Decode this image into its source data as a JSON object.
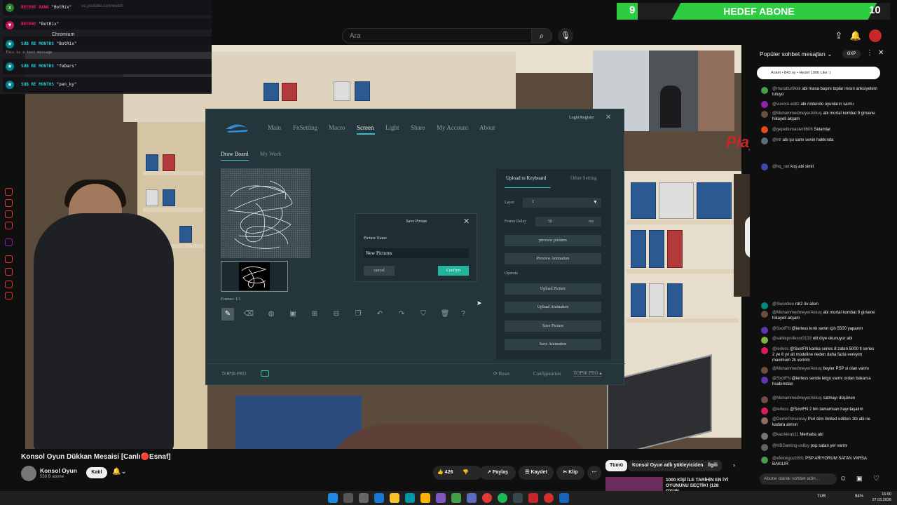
{
  "youtube": {
    "search_placeholder": "Ara",
    "video_title": "Konsol Oyun Dükkan Mesaisi [Canlı🔴Esnaf]",
    "channel_name": "Konsol Oyun",
    "channel_subs": "538 B abone",
    "join_label": "Katıl",
    "like_count": "426",
    "share_label": "Paylaş",
    "save_label": "Kaydet",
    "clip_label": "Klip",
    "related_chips": [
      "Tümü",
      "Konsol Oyun adlı yükleyiciden",
      "İlgili"
    ],
    "related_video_title": "1000 KİŞİ İLE TARİHİN EN İYİ OYUNUNU SEÇTİK! (128 OYUN..."
  },
  "stream_overlay": {
    "subgoal": {
      "current": "9",
      "title": "HEDEF ABONE",
      "target": "10"
    },
    "alerts": [
      {
        "label": "RECENT RANK",
        "text": "\"BotRix\"",
        "color": "#2e7d32",
        "icon": "x"
      },
      {
        "label": "RECENT",
        "text": "\"BotRix\"",
        "color": "#c2185b",
        "icon": "♥"
      },
      {
        "label": "SUB RE MONTHS",
        "text": "\"BotRix\"",
        "color": "#00838f",
        "icon": "★"
      },
      {
        "label": "SUB RE MONTHS",
        "text": "\"feDars\"",
        "color": "#00838f",
        "icon": "★"
      },
      {
        "label": "SUB RE MONTHS",
        "text": "\"pen_ky\"",
        "color": "#00838f",
        "icon": "★"
      }
    ],
    "chatbox_line": "This is a test message",
    "browser_url": "uc.youtube.com/watch",
    "browser_tab": "Chromium",
    "watermark": "PlayNoGame"
  },
  "app": {
    "nav": [
      "Main",
      "FnSetting",
      "Macro",
      "Screen",
      "Light",
      "Share",
      "My Account",
      "About"
    ],
    "active_nav": "Screen",
    "login_label": "Login/Register",
    "subtabs": [
      "Draw Board",
      "My Work"
    ],
    "frames_label": "Frames: 1/1",
    "tools": [
      "pen-icon",
      "eraser-icon",
      "fill-icon",
      "image-icon",
      "add-frame-icon",
      "remove-frame-icon",
      "copy-frame-icon",
      "undo-icon",
      "redo-icon",
      "stamp-icon",
      "trash-icon",
      "help-icon"
    ],
    "dialog": {
      "title": "Save Picture",
      "field_label": "Picture Name",
      "field_value": "New Pictures",
      "cancel_label": "cancel",
      "confirm_label": "Confirm"
    },
    "right_panel": {
      "tabs": [
        "Upload to Keyboard",
        "Other Setting"
      ],
      "layer_label": "Layer",
      "layer_value": "1",
      "frame_delay_label": "Frame Delay",
      "frame_delay_value": "50",
      "frame_delay_unit": "ms",
      "operate_label": "Operate",
      "buttons_top": [
        "preview pictures",
        "Preview Animation"
      ],
      "buttons_operate": [
        "Upload Picture",
        "Upload Animation",
        "Save Picture",
        "Save Animation"
      ]
    },
    "footer": {
      "model": "TOP98 PRO",
      "reset_label": "Reset",
      "configuration_label": "Configuration",
      "configuration_value": "TOP98 PRO"
    }
  },
  "chat": {
    "header": "Popüler sohbet mesajları",
    "badge": "OXP",
    "poll": "Anket • 843 oy • Hedef 1000 Like :)",
    "input_placeholder": "Abone olarak sohbet edin...",
    "messages_top": [
      {
        "user": "@murattur9kkk",
        "text": "abi masa başını toplar mısın anksiyetem tutuyo",
        "color": "#43a047"
      },
      {
        "user": "@vusoro-editz",
        "text": "abi nintendo oyunların varmı",
        "color": "#8e24aa"
      },
      {
        "user": "@MuhammedmeyerAkkuş",
        "text": "abi mortal kombat 9 girsene hikayeli akşam",
        "color": "#6d4c41"
      },
      {
        "user": "@gepettomaster8606",
        "text": "Selamlar",
        "color": "#e64a19"
      },
      {
        "user": "@lrtr",
        "text": "abi şu samı senin hakkında",
        "color": "#546e7a"
      },
      {
        "user": "@hq_net",
        "text": "koş abi simit",
        "color": "#3949ab"
      }
    ],
    "messages_bottom": [
      {
        "user": "@Swordiee",
        "text": "rdr2 öv alsın",
        "color": "#00897b"
      },
      {
        "user": "@MuhammedmeyerAkkuş",
        "text": "abi mortal kombat 9 girsene hikayeli akşam",
        "color": "#6d4c41"
      },
      {
        "user": "@SxotFN",
        "text": "@ierless kırık senin için 5500 yaparım",
        "color": "#5e35b1"
      },
      {
        "user": "@sahteprofesor3133",
        "text": "elit diye okunuyor abi",
        "color": "#7cb342"
      },
      {
        "user": "@ierless",
        "text": "@SxotFN kanka series 8 zaten 5000 tl series 2 ye 6 yıl alt modeline neden daha fazla vereyim maximum 2k veririm",
        "color": "#d81b60"
      },
      {
        "user": "@MuhammedmeyerAkkuş",
        "text": "beyler PSP si olan varmı",
        "color": "#6d4c41"
      },
      {
        "user": "@SxotFN",
        "text": "@ierless sende letgo varmı ordan bakarsa hsabımdan",
        "color": "#5e35b1"
      },
      {
        "user": "@MuhammedmeyerAkkuş",
        "text": "satmayı düşünen",
        "color": "#6d4c41"
      },
      {
        "user": "@ierless",
        "text": "@SxotFN 2 bin tamamsan hayırlaşalım",
        "color": "#d81b60"
      },
      {
        "user": "@DemirPorsemay",
        "text": "Ps4 slim limited edition 1tb abi ne kadara alırsın",
        "color": "#8d6e63"
      },
      {
        "user": "@kazıkkralı11",
        "text": "Merhaba abi",
        "color": "#757575"
      },
      {
        "user": "@HBGaming-ux8sy",
        "text": "psp satan yer varmı",
        "color": "#616161"
      },
      {
        "user": "@efetokgoz1601",
        "text": "PSP ARIYORUM SATAN VARSA BAKILIR",
        "color": "#43a047"
      }
    ]
  },
  "taskbar": {
    "language": "TUR",
    "battery": "94%",
    "time": "16:00",
    "date": "27.03.2026"
  }
}
